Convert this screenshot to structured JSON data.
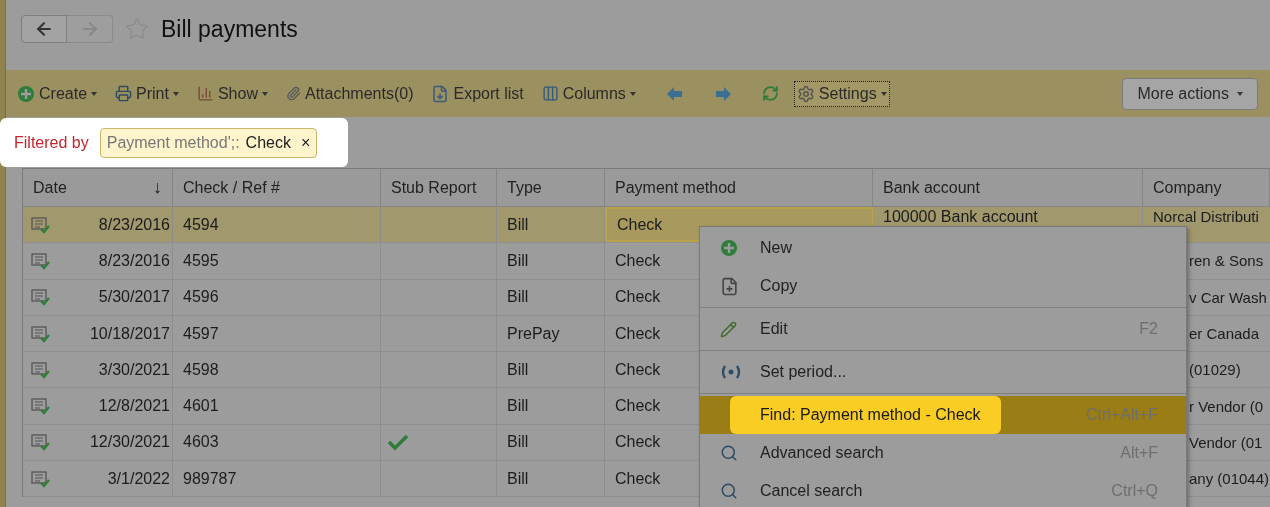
{
  "header": {
    "title": "Bill payments",
    "favorite": false
  },
  "toolbar": [
    {
      "label": "Create",
      "has_menu": true,
      "focused": false
    },
    {
      "label": "Print",
      "has_menu": true,
      "focused": false
    },
    {
      "label": "Show",
      "has_menu": true,
      "focused": false
    },
    {
      "label": "Attachments(0)",
      "has_menu": false,
      "focused": false
    },
    {
      "label": "Export list",
      "has_menu": false,
      "focused": false
    },
    {
      "label": "Columns",
      "has_menu": true,
      "focused": false
    },
    {
      "label": "Settings",
      "has_menu": true,
      "focused": true
    }
  ],
  "more_actions": "More actions",
  "filter": {
    "label": "Filtered by",
    "field": "Payment method';:",
    "value": "Check",
    "remove": "×"
  },
  "table": {
    "columns": [
      {
        "label": "Date",
        "sort": "↓"
      },
      {
        "label": "Check / Ref #"
      },
      {
        "label": "Stub Report"
      },
      {
        "label": "Type"
      },
      {
        "label": "Payment method"
      },
      {
        "label": "Bank account"
      },
      {
        "label": "Company"
      }
    ],
    "rows": [
      {
        "date": "8/23/2016",
        "ref": "4594",
        "stub": false,
        "type": "Bill",
        "method": "Check",
        "bank": "100000 Bank account",
        "company": "Norcal Distributi",
        "selected": true
      },
      {
        "date": "8/23/2016",
        "ref": "4595",
        "stub": false,
        "type": "Bill",
        "method": "Check",
        "company": "ren & Sons",
        "selected": false
      },
      {
        "date": "5/30/2017",
        "ref": "4596",
        "stub": false,
        "type": "Bill",
        "method": "Check",
        "company": "v Car Wash",
        "selected": false
      },
      {
        "date": "10/18/2017",
        "ref": "4597",
        "stub": false,
        "type": "PrePay",
        "method": "Check",
        "company": "er Canada",
        "selected": false
      },
      {
        "date": "3/30/2021",
        "ref": "4598",
        "stub": false,
        "type": "Bill",
        "method": "Check",
        "company": "(01029)",
        "selected": false
      },
      {
        "date": "12/8/2021",
        "ref": "4601",
        "stub": false,
        "type": "Bill",
        "method": "Check",
        "company": "r Vendor (0",
        "selected": false
      },
      {
        "date": "12/30/2021",
        "ref": "4603",
        "stub": true,
        "type": "Bill",
        "method": "Check",
        "company": "Vendor (01",
        "selected": false
      },
      {
        "date": "3/1/2022",
        "ref": "989787",
        "stub": false,
        "type": "Bill",
        "method": "Check",
        "company": "any (01044)",
        "selected": false
      }
    ]
  },
  "context_menu": [
    {
      "kind": "item",
      "label": "New",
      "selected": false
    },
    {
      "kind": "item",
      "label": "Copy",
      "selected": false
    },
    {
      "kind": "separator"
    },
    {
      "kind": "item",
      "label": "Edit",
      "shortcut": "F2",
      "selected": false
    },
    {
      "kind": "separator"
    },
    {
      "kind": "item",
      "label": "Set period...",
      "selected": false
    },
    {
      "kind": "separator"
    },
    {
      "kind": "item",
      "label": "Find: Payment method - Check",
      "shortcut": "Ctrl+Alt+F",
      "selected": true
    },
    {
      "kind": "item",
      "label": "Advanced search",
      "shortcut": "Alt+F",
      "selected": false
    },
    {
      "kind": "item",
      "label": "Cancel search",
      "shortcut": "Ctrl+Q",
      "selected": false
    }
  ]
}
